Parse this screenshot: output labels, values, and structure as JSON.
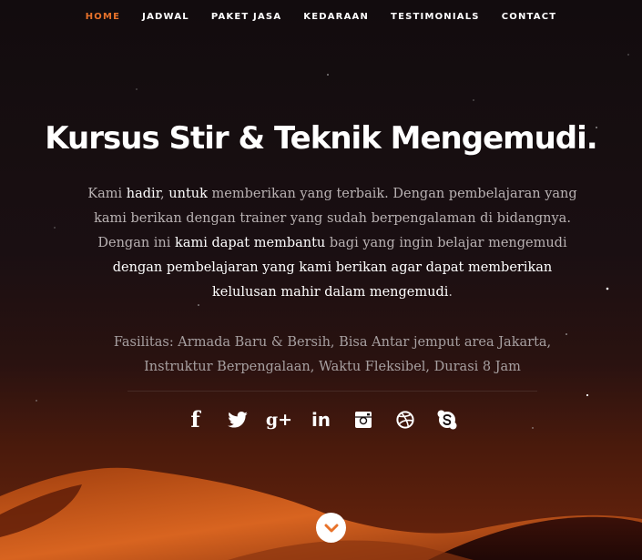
{
  "nav": {
    "items": [
      {
        "label": "HOME",
        "active": true
      },
      {
        "label": "JADWAL",
        "active": false
      },
      {
        "label": "PAKET JASA",
        "active": false
      },
      {
        "label": "KEDARAAN",
        "active": false
      },
      {
        "label": "TESTIMONIALS",
        "active": false
      },
      {
        "label": "CONTACT",
        "active": false
      }
    ],
    "active_color": "#e8722a"
  },
  "hero": {
    "title": "Kursus Stir & Teknik Mengemudi.",
    "description": {
      "p1": "Kami ",
      "h1": "hadir",
      "p2": ", ",
      "h2": "untuk",
      "p3": " memberikan yang terbaik. Dengan pembelajaran yang kami berikan dengan trainer yang sudah berpengalaman di bidangnya. Dengan ini ",
      "h3": "kami dapat membantu",
      "p4": " bagi yang ingin belajar mengemudi ",
      "h4": "dengan pembelajaran yang kami berikan agar dapat memberikan kelulusan mahir dalam mengemudi",
      "p5": "."
    },
    "facilities": "Fasilitas: Armada Baru & Bersih, Bisa Antar jemput area Jakarta, Instruktur Berpengalaan, Waktu Fleksibel, Durasi 8 Jam"
  },
  "social": {
    "icons": [
      {
        "name": "facebook-icon",
        "glyph": "f"
      },
      {
        "name": "twitter-icon",
        "glyph": ""
      },
      {
        "name": "google-plus-icon",
        "glyph": "g+"
      },
      {
        "name": "linkedin-icon",
        "glyph": "in"
      },
      {
        "name": "instagram-icon",
        "glyph": ""
      },
      {
        "name": "dribbble-icon",
        "glyph": ""
      },
      {
        "name": "skype-icon",
        "glyph": ""
      }
    ]
  },
  "scroll_button": {
    "icon": "chevron-down-icon",
    "color": "#e8722a"
  },
  "colors": {
    "accent": "#e8722a",
    "background": "#140c0d",
    "dune": "#c4501a"
  }
}
